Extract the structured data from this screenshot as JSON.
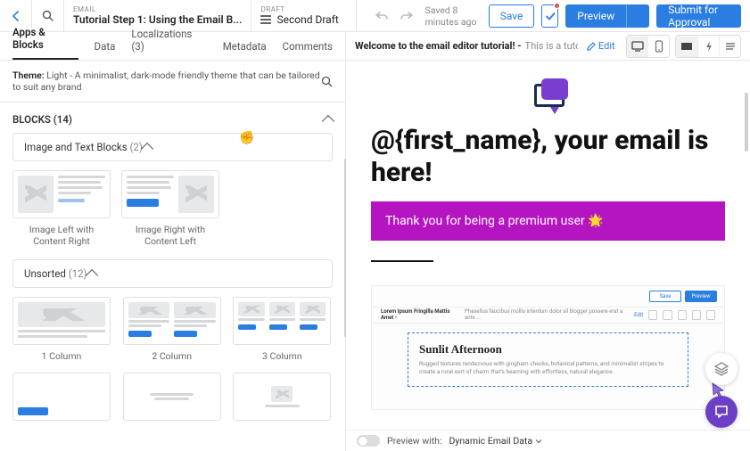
{
  "header": {
    "doc_type_label": "EMAIL",
    "title": "Tutorial Step 1: Using the Email B...",
    "draft_label": "DRAFT",
    "draft_value": "Second Draft",
    "saved_text": "Saved 8 minutes ago",
    "save_label": "Save",
    "preview_label": "Preview",
    "submit_label": "Submit for Approval"
  },
  "tabs": {
    "apps_blocks": "Apps & Blocks",
    "data": "Data",
    "localizations": "Localizations (3)",
    "metadata": "Metadata",
    "comments": "Comments"
  },
  "theme": {
    "prefix": "Theme:",
    "name": "Light",
    "desc": " - A minimalist, dark-mode friendly theme that can be tailored to suit any brand"
  },
  "blocks": {
    "section_label": "BLOCKS (14)",
    "group_image_text": {
      "label": "Image and Text Blocks",
      "count": "(2)"
    },
    "image_left_label": "Image Left with Content Right",
    "image_right_label": "Image Right with Content Left",
    "group_unsorted": {
      "label": "Unsorted",
      "count": "(12)"
    },
    "col1_label": "1 Column",
    "col2_label": "2 Column",
    "col3_label": "3 Column"
  },
  "preview": {
    "welcome_strong": "Welcome to the email editor tutorial! - ",
    "welcome_muted": "This is a tutorial, and ...",
    "edit_label": "Edit"
  },
  "email": {
    "headline": "@{first_name}, your email is here!",
    "banner_text": "Thank you for being a premium user 🌟",
    "nested_subject": "Lorem Ipsum Fringilla Mattis Amet -",
    "nested_subject_muted": " Phasellus faucibus mollis interdum dolor sil blogger possere erat a ante ...",
    "nested_edit": "Edit",
    "nested_title": "Sunlit Afternoon",
    "nested_copy": "Rugged textures rendezvous with gingham checks, botanical patterns, and minimalist stripes to create a rural sort of charm that's beaming with effortless, natural elegance.",
    "nested_save": "Save",
    "nested_preview": "Preview"
  },
  "footer": {
    "preview_with_label": "Preview with:",
    "preview_with_value": "Dynamic Email Data"
  }
}
